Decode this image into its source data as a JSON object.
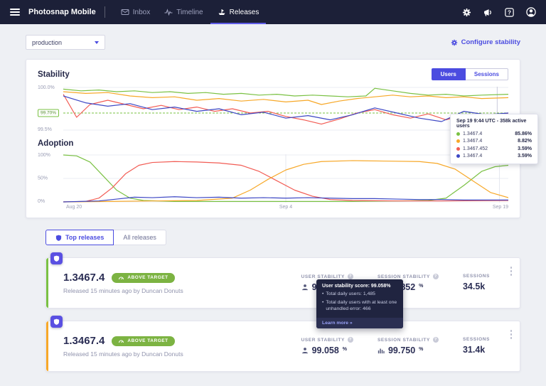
{
  "icons": {
    "help_glyph": "?",
    "info_glyph": "?",
    "bullet_glyph": "•"
  },
  "nav": {
    "app_title": "Photosnap Mobile",
    "items": [
      {
        "label": "Inbox"
      },
      {
        "label": "Timeline"
      },
      {
        "label": "Releases"
      }
    ]
  },
  "toolbar": {
    "environment": "production",
    "configure_label": "Configure stability"
  },
  "charts_panel": {
    "stability_title": "Stability",
    "adoption_title": "Adoption",
    "toggle_users": "Users",
    "toggle_sessions": "Sessions",
    "stability_y_labels": [
      "100.0%",
      "99.70%",
      "99.5%"
    ],
    "adoption_y_labels": [
      "100%",
      "50%",
      "0%"
    ],
    "x_labels": [
      "Aug 20",
      "Sep 4",
      "Sep 19"
    ]
  },
  "chart_tooltip": {
    "title": "Sep 19 9:44 UTC - 358k active users",
    "rows": [
      {
        "version": "1.3467.4",
        "value": "85.86%",
        "color": "#7ac143"
      },
      {
        "version": "1.3467.4",
        "value": "8.82%",
        "color": "#f7a828"
      },
      {
        "version": "1.3467.452",
        "value": "3.59%",
        "color": "#f25c54"
      },
      {
        "version": "1.3467.4",
        "value": "3.59%",
        "color": "#3d47c4"
      }
    ]
  },
  "chart_data": [
    {
      "name": "stability",
      "type": "line",
      "title": "Stability",
      "ylim": [
        99.5,
        100.0
      ],
      "target": 99.7,
      "hgrid": [
        100.0,
        99.5
      ],
      "vgrid": [
        97.5
      ],
      "vgrid_color": "#c9cbda",
      "y_ticks": [
        "100.0%",
        "99.70%",
        "99.5%"
      ],
      "series": [
        {
          "name": "1.3467.4",
          "color": "#7ac143",
          "points": [
            [
              0,
              99.98
            ],
            [
              4,
              99.96
            ],
            [
              8,
              99.97
            ],
            [
              12,
              99.95
            ],
            [
              16,
              99.96
            ],
            [
              20,
              99.94
            ],
            [
              24,
              99.95
            ],
            [
              28,
              99.93
            ],
            [
              32,
              99.94
            ],
            [
              36,
              99.92
            ],
            [
              40,
              99.93
            ],
            [
              44,
              99.91
            ],
            [
              48,
              99.92
            ],
            [
              52,
              99.9
            ],
            [
              56,
              99.91
            ],
            [
              60,
              99.9
            ],
            [
              64,
              99.89
            ],
            [
              68,
              99.9
            ],
            [
              70,
              99.99
            ],
            [
              74,
              99.96
            ],
            [
              78,
              99.93
            ],
            [
              82,
              99.91
            ],
            [
              86,
              99.92
            ],
            [
              90,
              99.9
            ],
            [
              94,
              99.91
            ],
            [
              100,
              99.92
            ]
          ]
        },
        {
          "name": "1.3467.4",
          "color": "#f7a828",
          "points": [
            [
              0,
              99.95
            ],
            [
              5,
              99.93
            ],
            [
              10,
              99.94
            ],
            [
              15,
              99.9
            ],
            [
              20,
              99.88
            ],
            [
              25,
              99.89
            ],
            [
              30,
              99.85
            ],
            [
              35,
              99.87
            ],
            [
              40,
              99.84
            ],
            [
              45,
              99.86
            ],
            [
              50,
              99.83
            ],
            [
              55,
              99.85
            ],
            [
              58,
              99.8
            ],
            [
              62,
              99.84
            ],
            [
              66,
              99.87
            ],
            [
              70,
              99.89
            ],
            [
              74,
              99.91
            ],
            [
              78,
              99.89
            ],
            [
              82,
              99.9
            ],
            [
              86,
              99.88
            ],
            [
              90,
              99.89
            ],
            [
              94,
              99.87
            ],
            [
              100,
              99.88
            ]
          ]
        },
        {
          "name": "1.3467.452",
          "color": "#f25c54",
          "points": [
            [
              0,
              99.92
            ],
            [
              3,
              99.65
            ],
            [
              6,
              99.8
            ],
            [
              10,
              99.85
            ],
            [
              14,
              99.8
            ],
            [
              18,
              99.75
            ],
            [
              22,
              99.79
            ],
            [
              26,
              99.74
            ],
            [
              30,
              99.77
            ],
            [
              34,
              99.72
            ],
            [
              38,
              99.75
            ],
            [
              42,
              99.7
            ],
            [
              46,
              99.72
            ],
            [
              50,
              99.66
            ],
            [
              54,
              99.62
            ],
            [
              58,
              99.57
            ],
            [
              62,
              99.63
            ],
            [
              66,
              99.7
            ],
            [
              70,
              99.74
            ],
            [
              74,
              99.68
            ],
            [
              78,
              99.64
            ],
            [
              82,
              99.69
            ],
            [
              86,
              99.62
            ],
            [
              90,
              99.68
            ],
            [
              94,
              99.64
            ],
            [
              100,
              99.7
            ]
          ]
        },
        {
          "name": "1.3467.4",
          "color": "#3d47c4",
          "points": [
            [
              0,
              99.9
            ],
            [
              5,
              99.82
            ],
            [
              10,
              99.78
            ],
            [
              15,
              99.81
            ],
            [
              20,
              99.74
            ],
            [
              25,
              99.77
            ],
            [
              30,
              99.72
            ],
            [
              35,
              99.75
            ],
            [
              40,
              99.68
            ],
            [
              45,
              99.71
            ],
            [
              50,
              99.64
            ],
            [
              55,
              99.67
            ],
            [
              60,
              99.62
            ],
            [
              65,
              99.68
            ],
            [
              70,
              99.76
            ],
            [
              75,
              99.7
            ],
            [
              80,
              99.64
            ],
            [
              85,
              99.6
            ],
            [
              90,
              99.72
            ],
            [
              95,
              99.68
            ],
            [
              100,
              99.7
            ]
          ]
        }
      ]
    },
    {
      "name": "adoption",
      "type": "line",
      "title": "Adoption",
      "ylim": [
        0,
        100
      ],
      "hgrid": [
        0,
        50,
        100
      ],
      "vgrid": [
        50,
        98
      ],
      "vgrid_color": "#e6e7ef",
      "y_ticks": [
        "100%",
        "50%",
        "0%"
      ],
      "x_ticks": [
        "Aug 20",
        "Sep 4",
        "Sep 19"
      ],
      "series": [
        {
          "name": "1.3467.4",
          "color": "#7ac143",
          "points": [
            [
              0,
              100
            ],
            [
              3,
              98
            ],
            [
              6,
              85
            ],
            [
              9,
              55
            ],
            [
              12,
              25
            ],
            [
              15,
              8
            ],
            [
              18,
              3
            ],
            [
              25,
              1
            ],
            [
              35,
              1
            ],
            [
              45,
              1
            ],
            [
              55,
              1
            ],
            [
              65,
              1
            ],
            [
              75,
              2
            ],
            [
              82,
              3
            ],
            [
              86,
              8
            ],
            [
              90,
              35
            ],
            [
              94,
              65
            ],
            [
              97,
              75
            ],
            [
              100,
              78
            ]
          ]
        },
        {
          "name": "1.3467.452",
          "color": "#f25c54",
          "points": [
            [
              0,
              0
            ],
            [
              5,
              1
            ],
            [
              8,
              8
            ],
            [
              11,
              30
            ],
            [
              14,
              60
            ],
            [
              17,
              78
            ],
            [
              20,
              84
            ],
            [
              25,
              86
            ],
            [
              30,
              85
            ],
            [
              35,
              83
            ],
            [
              40,
              78
            ],
            [
              44,
              65
            ],
            [
              48,
              45
            ],
            [
              52,
              25
            ],
            [
              56,
              12
            ],
            [
              60,
              5
            ],
            [
              65,
              3
            ],
            [
              75,
              2
            ],
            [
              85,
              2
            ],
            [
              100,
              3
            ]
          ]
        },
        {
          "name": "1.3467.4",
          "color": "#f7a828",
          "points": [
            [
              0,
              0
            ],
            [
              10,
              1
            ],
            [
              20,
              2
            ],
            [
              30,
              3
            ],
            [
              38,
              8
            ],
            [
              42,
              25
            ],
            [
              46,
              48
            ],
            [
              50,
              68
            ],
            [
              54,
              80
            ],
            [
              58,
              86
            ],
            [
              65,
              88
            ],
            [
              72,
              87
            ],
            [
              80,
              86
            ],
            [
              84,
              82
            ],
            [
              88,
              70
            ],
            [
              92,
              45
            ],
            [
              96,
              20
            ],
            [
              100,
              9
            ]
          ]
        },
        {
          "name": "1.3467.4",
          "color": "#3d47c4",
          "points": [
            [
              0,
              0
            ],
            [
              8,
              2
            ],
            [
              12,
              6
            ],
            [
              16,
              10
            ],
            [
              20,
              9
            ],
            [
              25,
              11
            ],
            [
              30,
              9
            ],
            [
              35,
              10
            ],
            [
              40,
              8
            ],
            [
              45,
              9
            ],
            [
              50,
              8
            ],
            [
              55,
              9
            ],
            [
              60,
              8
            ],
            [
              65,
              7
            ],
            [
              70,
              7
            ],
            [
              75,
              6
            ],
            [
              80,
              5
            ],
            [
              85,
              5
            ],
            [
              90,
              4
            ],
            [
              95,
              4
            ],
            [
              100,
              4
            ]
          ]
        }
      ]
    }
  ],
  "tabs": {
    "top_releases": "Top releases",
    "all_releases": "All releases"
  },
  "stats_labels": {
    "user": "User stability",
    "session": "Session stability",
    "sessions": "Sessions",
    "unit": "%"
  },
  "releases": [
    {
      "version": "1.3467.4",
      "target_badge": "Above target",
      "released_text": "Released 15 minutes ago by Duncan Donuts",
      "user_stability": "99.058",
      "session_stability": "99.852",
      "sessions": "34.5k",
      "accent_color": "#7ac143"
    },
    {
      "version": "1.3467.4",
      "target_badge": "Above target",
      "released_text": "Released 15 minutes ago by Duncan Donuts",
      "user_stability": "99.058",
      "session_stability": "99.750",
      "sessions": "31.4k",
      "accent_color": "#f7a828"
    }
  ],
  "stability_tooltip": {
    "title": "User stability score: 99.058%",
    "bullets": [
      "Total daily users: 1,485",
      "Total daily users with at least one unhandled error: 466"
    ],
    "link_label": "Learn more »"
  }
}
